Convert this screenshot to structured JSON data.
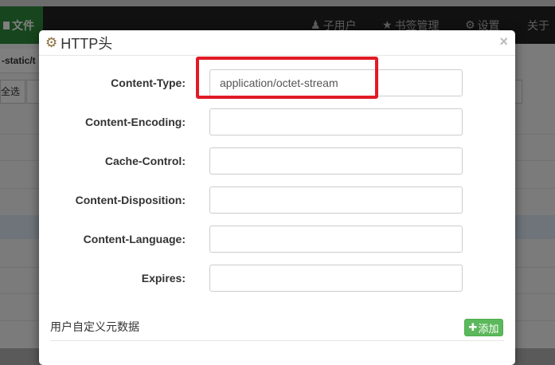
{
  "background": {
    "file_label": "文件",
    "nav_items": [
      {
        "icon": "users-icon",
        "label": "子用户"
      },
      {
        "icon": "star-icon",
        "label": "书签管理"
      },
      {
        "icon": "gear-icon",
        "label": "设置"
      },
      {
        "icon": "",
        "label": "关于"
      }
    ],
    "path_text": "-static/t",
    "select_all": "全选"
  },
  "modal": {
    "title": "HTTP头",
    "title_icon": "gear-icon",
    "close_label": "×",
    "fields": [
      {
        "label": "Content-Type:",
        "value": "application/octet-stream",
        "placeholder": ""
      },
      {
        "label": "Content-Encoding:",
        "value": "",
        "placeholder": ""
      },
      {
        "label": "Cache-Control:",
        "value": "",
        "placeholder": ""
      },
      {
        "label": "Content-Disposition:",
        "value": "",
        "placeholder": ""
      },
      {
        "label": "Content-Language:",
        "value": "",
        "placeholder": ""
      },
      {
        "label": "Expires:",
        "value": "",
        "placeholder": ""
      }
    ],
    "meta_title": "用户自定义元数据",
    "add_label": "添加",
    "add_icon": "plus-icon"
  },
  "colors": {
    "highlight": "#e01b26",
    "add_button": "#5cb85c",
    "file_button": "#2e8b3a"
  }
}
